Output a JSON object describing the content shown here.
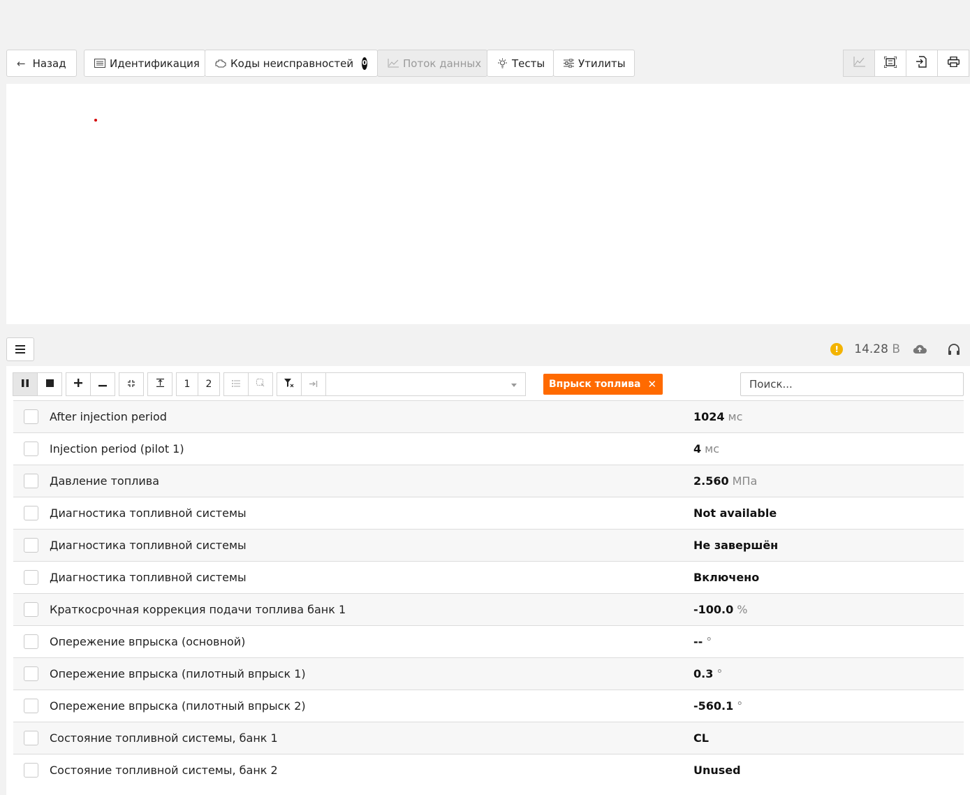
{
  "nav": {
    "back": "Назад",
    "identification": "Идентификация",
    "dtc": "Коды неисправностей",
    "dtc_count": "0",
    "data_stream": "Поток данных",
    "tests": "Тесты",
    "utilities": "Утилиты"
  },
  "status": {
    "voltage": "14.28",
    "voltage_unit": "В"
  },
  "toolbar": {
    "page1": "1",
    "page2": "2",
    "filter_tag": "Впрыск топлива",
    "search_placeholder": "Поиск..."
  },
  "rows": [
    {
      "name": "After injection period",
      "value": "1024",
      "unit": "мс"
    },
    {
      "name": "Injection period (pilot 1)",
      "value": "4",
      "unit": "мс"
    },
    {
      "name": "Давление топлива",
      "value": "2.560",
      "unit": "МПа"
    },
    {
      "name": "Диагностика топливной системы",
      "value": "Not available",
      "unit": ""
    },
    {
      "name": "Диагностика топливной системы",
      "value": "Не завершён",
      "unit": ""
    },
    {
      "name": "Диагностика топливной системы",
      "value": "Включено",
      "unit": ""
    },
    {
      "name": "Краткосрочная коррекция подачи топлива банк 1",
      "value": "-100.0",
      "unit": "%"
    },
    {
      "name": "Опережение впрыска (основной)",
      "value": "--",
      "unit": "°"
    },
    {
      "name": "Опережение впрыска (пилотный впрыск 1)",
      "value": "0.3",
      "unit": "°"
    },
    {
      "name": "Опережение впрыска (пилотный впрыск 2)",
      "value": "-560.1",
      "unit": "°"
    },
    {
      "name": "Состояние топливной системы, банк 1",
      "value": "CL",
      "unit": ""
    },
    {
      "name": "Состояние топливной системы, банк 2",
      "value": "Unused",
      "unit": ""
    }
  ],
  "colors": {
    "accent": "#ff6a00",
    "warning": "#f3b300"
  }
}
